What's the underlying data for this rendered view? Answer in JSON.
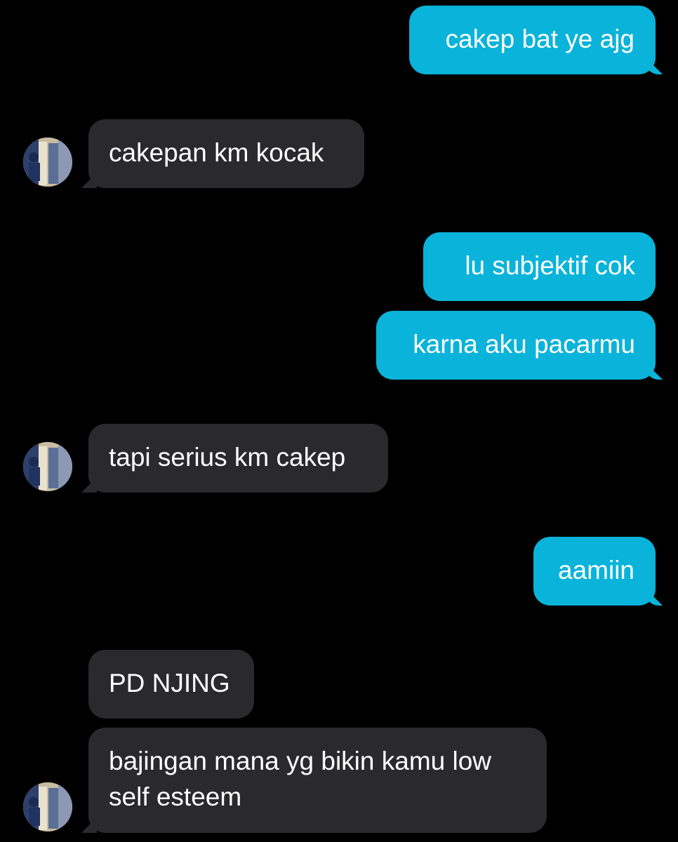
{
  "conversation": {
    "messages": [
      {
        "side": "sent",
        "text": "cakep bat ye ajg"
      },
      {
        "side": "received",
        "text": "cakepan km kocak"
      },
      {
        "side": "sent",
        "text": "lu subjektif cok"
      },
      {
        "side": "sent",
        "text": "karna aku pacarmu"
      },
      {
        "side": "received",
        "text": "tapi serius km cakep"
      },
      {
        "side": "sent",
        "text": "aamiin"
      },
      {
        "side": "received",
        "text": "PD NJING"
      },
      {
        "side": "received",
        "lines": [
          "bajingan mana yg bikin kamu low",
          "self esteem"
        ]
      }
    ],
    "colors": {
      "sent_bubble": "#0ab3d9",
      "received_bubble": "#2a2a2c",
      "background": "#000000",
      "text": "#ffffff"
    },
    "avatar_icon": "contact-avatar-icon"
  }
}
